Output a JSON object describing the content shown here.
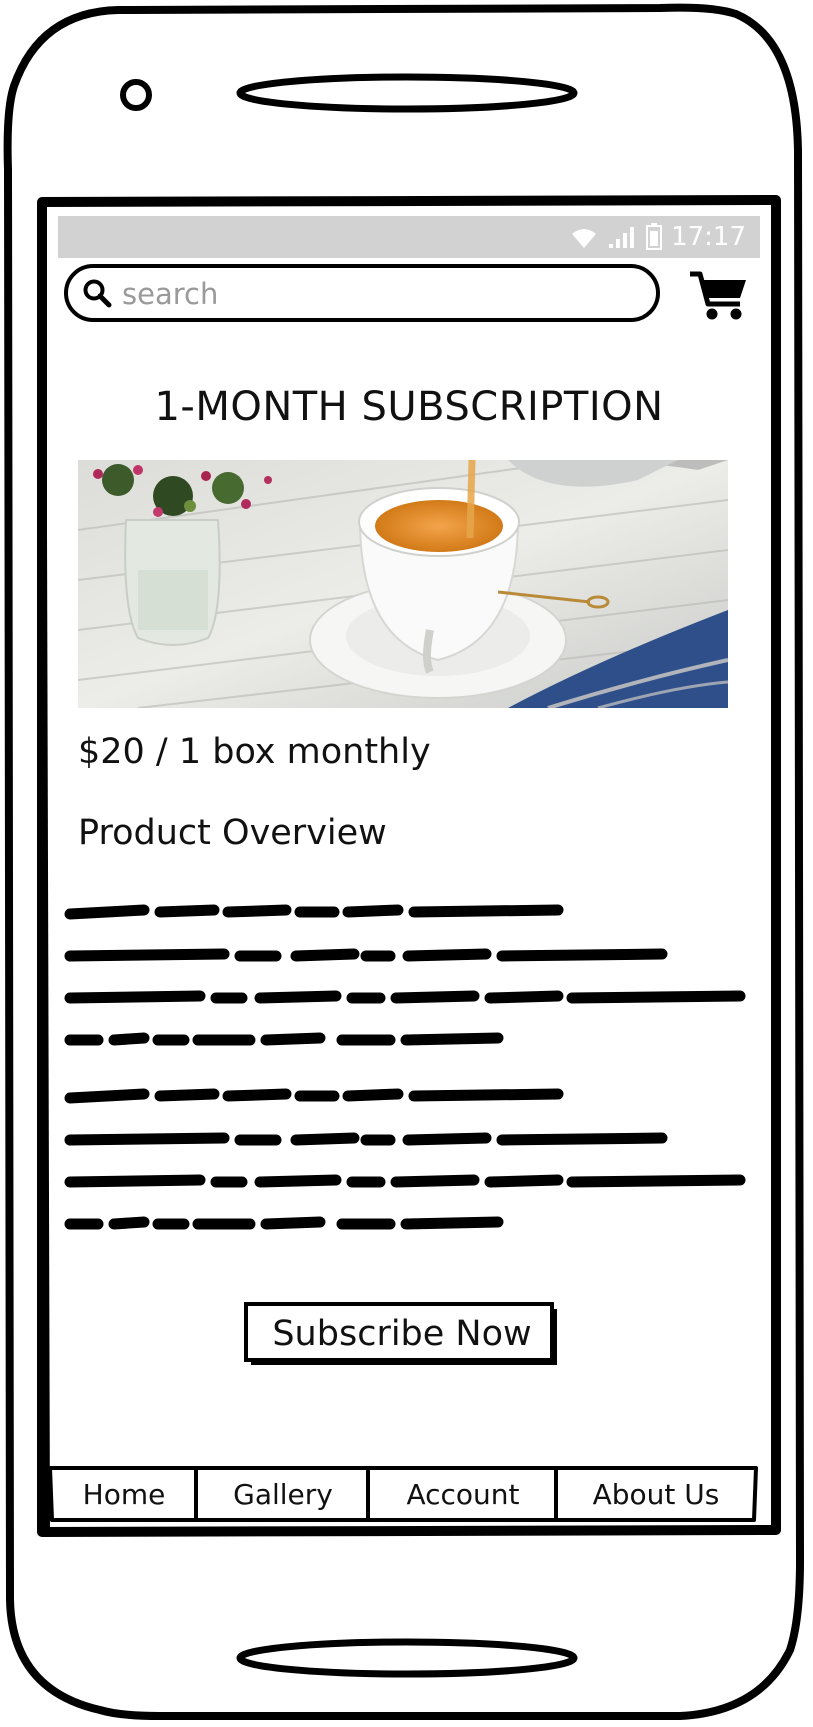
{
  "status_bar": {
    "wifi_icon": "wifi-icon",
    "signal_icon": "signal-icon",
    "battery_icon": "battery-icon",
    "time": "17:17"
  },
  "search": {
    "placeholder": "search",
    "icon": "search-icon"
  },
  "cart": {
    "icon": "shopping-cart-icon"
  },
  "product": {
    "title": "1-MONTH SUBSCRIPTION",
    "image": "tea-cup-photo",
    "price": "$20 / 1 box monthly",
    "overview_heading": "Product Overview"
  },
  "actions": {
    "subscribe_label": "Subscribe Now"
  },
  "tabs": [
    {
      "label": "Home"
    },
    {
      "label": "Gallery"
    },
    {
      "label": "Account"
    },
    {
      "label": "About Us"
    }
  ],
  "colors": {
    "ink": "#000000",
    "status_bar": "#d2d2d2",
    "placeholder": "#9a9a9a"
  }
}
